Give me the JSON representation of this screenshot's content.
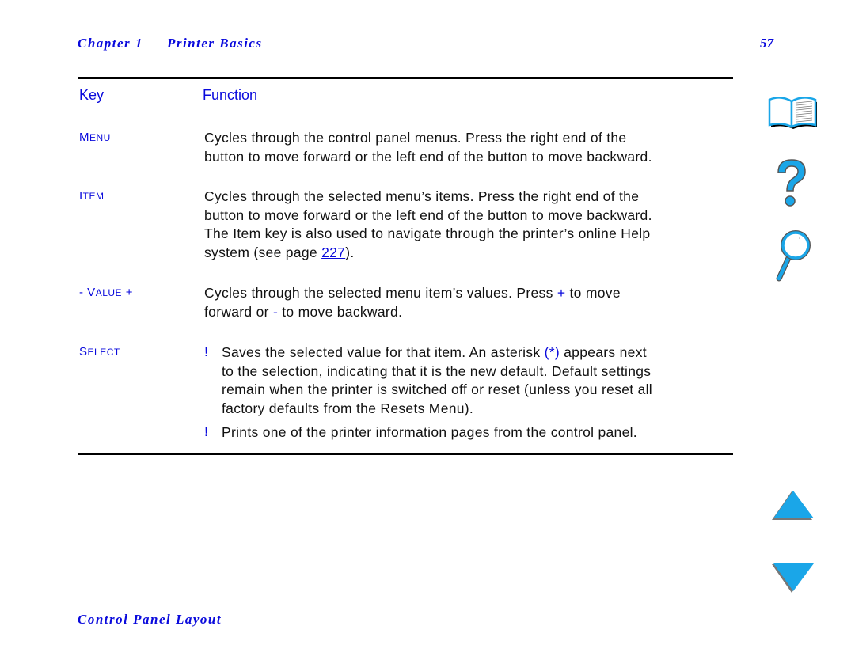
{
  "header": {
    "chapter_label": "Chapter 1",
    "chapter_title": "Printer Basics",
    "page_number": "57"
  },
  "table": {
    "columns": [
      "Key",
      "Function"
    ],
    "rows": [
      {
        "key_initial": "M",
        "key_rest": "ENU",
        "lines": [
          "Cycles through the control panel menus. Press the right end of the",
          "button to move forward or the left end of the button to move backward."
        ]
      },
      {
        "key_initial": "I",
        "key_rest": "TEM",
        "lines": [
          "Cycles through the selected menu’s items. Press the right end of the",
          "button to move forward or the left end of the button to move backward.",
          "The Item key is also used to navigate through the printer’s online Help"
        ],
        "last_line_prefix": "system (see page ",
        "link_text": "227",
        "last_line_suffix": ")."
      },
      {
        "key_prefix": "- ",
        "key_initial": "V",
        "key_rest": "ALUE",
        "key_suffix": " +",
        "line1_prefix": "Cycles through the selected menu item’s values. Press ",
        "line1_plus": "+",
        "line1_suffix": " to move",
        "line2_prefix": "forward or ",
        "line2_minus": "-",
        "line2_suffix": " to move backward."
      },
      {
        "key_initial": "S",
        "key_rest": "ELECT",
        "bullet_symbol": "!",
        "bullets": [
          {
            "line1_prefix": "Saves the selected value for that item. An asterisk ",
            "line1_highlight": "(*)",
            "line1_suffix": " appears next",
            "more_lines": [
              "to the selection, indicating that it is the new default. Default settings",
              "remain when the printer is switched off or reset (unless you reset all",
              "factory defaults from the Resets Menu)."
            ]
          },
          {
            "text": "Prints one of the printer information pages from the control panel."
          }
        ]
      }
    ]
  },
  "footer": {
    "section_title": "Control Panel Layout"
  },
  "nav": {
    "icons": [
      "book-icon",
      "help-icon",
      "search-icon",
      "previous-page-icon",
      "next-page-icon"
    ],
    "accent_color": "#1aa6e8"
  }
}
